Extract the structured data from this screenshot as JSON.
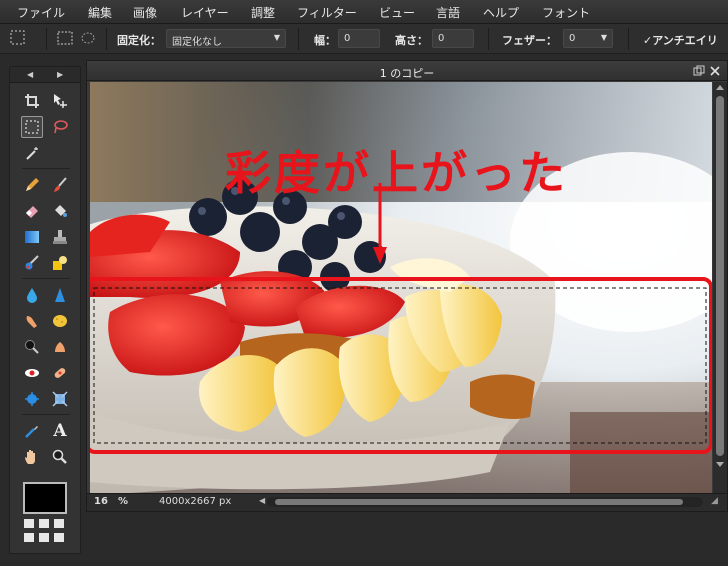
{
  "menu": {
    "items": [
      "ファイル",
      "編集",
      "画像",
      "レイヤー",
      "調整",
      "フィルター",
      "ビュー",
      "言語",
      "ヘルプ",
      "フォント"
    ]
  },
  "options": {
    "fix_label": "固定化：",
    "fix_value": "固定化なし",
    "width_label": "幅：",
    "width_value": "0",
    "height_label": "高さ：",
    "height_value": "0",
    "feather_label": "フェザー：",
    "feather_value": "0",
    "antialias_label": "アンチエイリ"
  },
  "document": {
    "title": "1 のコピー",
    "zoom": "16",
    "zoom_unit": "%",
    "dimensions": "4000x2667 px"
  },
  "annotation": {
    "text": "彩度が上がった",
    "color": "#e8141b"
  },
  "icons": {
    "tools": [
      "crop-icon",
      "move-icon",
      "marquee-icon",
      "lasso-icon",
      "magic-wand-icon",
      "pencil-icon",
      "brush-icon",
      "eraser-icon",
      "bucket-icon",
      "gradient-icon",
      "clone-stamp-icon",
      "color-replace-icon",
      "shapes-icon",
      "blur-icon",
      "sharpen-icon",
      "smudge-icon",
      "sponge-icon",
      "dodge-icon",
      "burn-icon",
      "red-eye-icon",
      "spot-heal-icon",
      "bloat-icon",
      "pinch-icon",
      "eyedropper-icon",
      "text-icon",
      "hand-icon",
      "zoom-icon"
    ]
  }
}
